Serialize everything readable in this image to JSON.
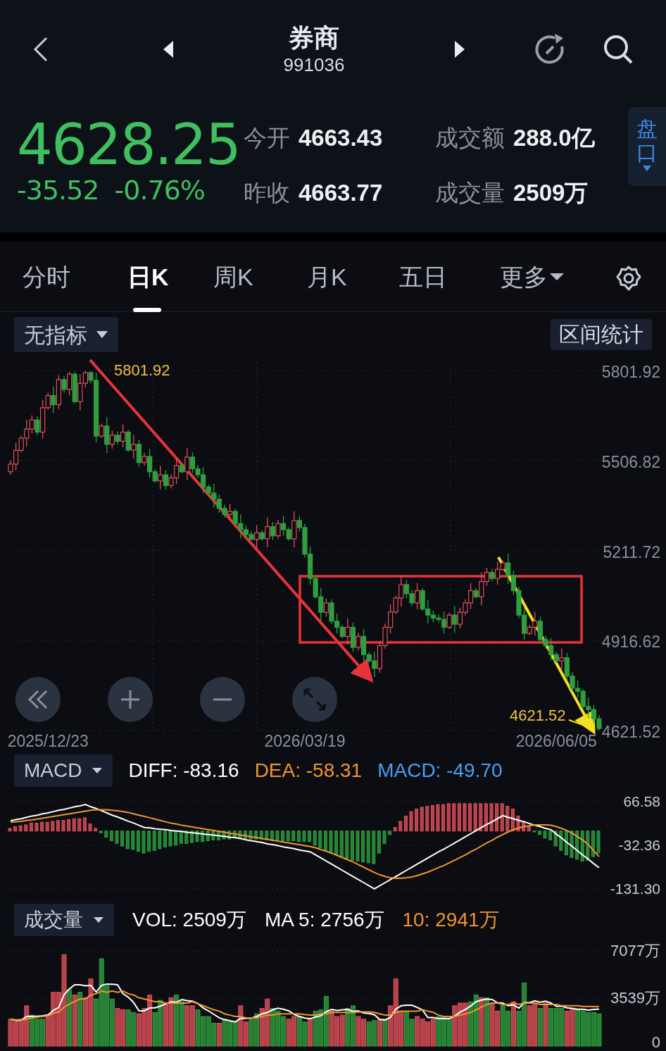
{
  "header": {
    "title": "券商",
    "code": "991036"
  },
  "quote": {
    "price": "4628.25",
    "change": "-35.52",
    "change_pct": "-0.76%",
    "stats": [
      {
        "label": "今开",
        "value": "4663.43"
      },
      {
        "label": "昨收",
        "value": "4663.77"
      },
      {
        "label": "成交额",
        "value": "288.0亿"
      },
      {
        "label": "成交量",
        "value": "2509万"
      }
    ],
    "side_tab": "盘口"
  },
  "tabs": [
    {
      "label": "分时",
      "selected": false
    },
    {
      "label": "日K",
      "selected": true
    },
    {
      "label": "周K",
      "selected": false
    },
    {
      "label": "月K",
      "selected": false
    },
    {
      "label": "五日",
      "selected": false
    },
    {
      "label": "更多",
      "selected": false
    }
  ],
  "kline": {
    "indicator": "无指标",
    "range_stats": "区间统计",
    "high_label": "5801.92",
    "low_label": "4621.52",
    "chart_data": {
      "type": "candlestick",
      "ylim": [
        4621.52,
        5801.92
      ],
      "grid": true,
      "yticks": [
        {
          "value": 5801.92,
          "label": "5801.92"
        },
        {
          "value": 5506.82,
          "label": "5506.82"
        },
        {
          "value": 5211.72,
          "label": "5211.72"
        },
        {
          "value": 4916.62,
          "label": "4916.62"
        },
        {
          "value": 4621.52,
          "label": "4621.52"
        }
      ],
      "categories": [
        null,
        null,
        null,
        null,
        null,
        null,
        null,
        "2025/12/23",
        null,
        null,
        null,
        null,
        null,
        null,
        null,
        null,
        null,
        null,
        null,
        null,
        null,
        null,
        null,
        null,
        null,
        null,
        null,
        null,
        null,
        null,
        null,
        null,
        null,
        null,
        null,
        null,
        null,
        null,
        null,
        null,
        null,
        null,
        null,
        null,
        null,
        null,
        null,
        null,
        null,
        null,
        null,
        null,
        null,
        null,
        null,
        "2026/03/19",
        null,
        null,
        null,
        null,
        null,
        null,
        null,
        null,
        null,
        null,
        null,
        null,
        null,
        null,
        null,
        null,
        null,
        null,
        null,
        null,
        null,
        null,
        null,
        null,
        null,
        null,
        null,
        null,
        null,
        null,
        null,
        null,
        null,
        null,
        null,
        null,
        null,
        null,
        null,
        null,
        null,
        null,
        null,
        null,
        null,
        null,
        "2026/06/05",
        null,
        null,
        null,
        null,
        null,
        null,
        null,
        null
      ],
      "ohlc": [
        [
          5470,
          5507,
          5460,
          5495
        ],
        [
          5495,
          5565,
          5475,
          5540
        ],
        [
          5540,
          5588,
          5534,
          5580
        ],
        [
          5580,
          5640,
          5552,
          5610
        ],
        [
          5610,
          5655,
          5596,
          5640
        ],
        [
          5640,
          5652,
          5590,
          5600
        ],
        [
          5600,
          5705,
          5580,
          5680
        ],
        [
          5680,
          5728,
          5674,
          5720
        ],
        [
          5720,
          5750,
          5662,
          5690
        ],
        [
          5690,
          5787,
          5676,
          5772
        ],
        [
          5772,
          5784,
          5730,
          5740
        ],
        [
          5740,
          5798,
          5720,
          5790
        ],
        [
          5790,
          5798,
          5694,
          5700
        ],
        [
          5700,
          5790,
          5672,
          5760
        ],
        [
          5760,
          5801.92,
          5746,
          5795
        ],
        [
          5795,
          5800,
          5760,
          5770
        ],
        [
          5770,
          5795,
          5567,
          5587
        ],
        [
          5587,
          5628,
          5581,
          5620
        ],
        [
          5620,
          5650,
          5532,
          5560
        ],
        [
          5560,
          5605,
          5546,
          5590
        ],
        [
          5590,
          5602,
          5560,
          5570
        ],
        [
          5570,
          5625,
          5550,
          5600
        ],
        [
          5600,
          5608,
          5535,
          5541
        ],
        [
          5541,
          5590,
          5513,
          5560
        ],
        [
          5560,
          5575,
          5486,
          5500
        ],
        [
          5500,
          5532,
          5490,
          5520
        ],
        [
          5520,
          5545,
          5450,
          5470
        ],
        [
          5470,
          5478,
          5434,
          5440
        ],
        [
          5440,
          5490,
          5412,
          5460
        ],
        [
          5460,
          5475,
          5411,
          5425
        ],
        [
          5425,
          5462,
          5415,
          5450
        ],
        [
          5450,
          5515,
          5430,
          5490
        ],
        [
          5490,
          5498,
          5464,
          5470
        ],
        [
          5470,
          5548,
          5442,
          5518
        ],
        [
          5518,
          5533,
          5466,
          5480
        ],
        [
          5480,
          5492,
          5450,
          5460
        ],
        [
          5460,
          5485,
          5400,
          5420
        ],
        [
          5420,
          5428,
          5394,
          5400
        ],
        [
          5400,
          5430,
          5352,
          5380
        ],
        [
          5380,
          5395,
          5336,
          5350
        ],
        [
          5350,
          5362,
          5320,
          5330
        ],
        [
          5330,
          5365,
          5310,
          5340
        ],
        [
          5340,
          5348,
          5294,
          5300
        ],
        [
          5300,
          5330,
          5252,
          5280
        ],
        [
          5280,
          5295,
          5250,
          5264
        ],
        [
          5264,
          5276,
          5246,
          5248
        ],
        [
          5248,
          5295,
          5220,
          5270
        ],
        [
          5270,
          5278,
          5244,
          5250
        ],
        [
          5250,
          5320,
          5222,
          5290
        ],
        [
          5290,
          5305,
          5246,
          5260
        ],
        [
          5260,
          5312,
          5250,
          5300
        ],
        [
          5300,
          5325,
          5260,
          5280
        ],
        [
          5280,
          5288,
          5244,
          5250
        ],
        [
          5250,
          5340,
          5222,
          5310
        ],
        [
          5310,
          5325,
          5273,
          5287
        ],
        [
          5287,
          5299,
          5190,
          5200
        ],
        [
          5200,
          5225,
          5100,
          5120
        ],
        [
          5120,
          5128,
          5054,
          5060
        ],
        [
          5060,
          5090,
          4981,
          5009
        ],
        [
          5009,
          5055,
          4995,
          5040
        ],
        [
          5040,
          5052,
          4970,
          4980
        ],
        [
          4980,
          5005,
          4940,
          4960
        ],
        [
          4960,
          4968,
          4924,
          4930
        ],
        [
          4930,
          4990,
          4902,
          4960
        ],
        [
          4960,
          4975,
          4880,
          4894
        ],
        [
          4894,
          4942,
          4884,
          4930
        ],
        [
          4930,
          4955,
          4850,
          4870
        ],
        [
          4870,
          4878,
          4844,
          4850
        ],
        [
          4850,
          4880,
          4797,
          4825
        ],
        [
          4825,
          4915,
          4811,
          4900
        ],
        [
          4900,
          4972,
          4890,
          4960
        ],
        [
          4960,
          5035,
          4940,
          5010
        ],
        [
          5010,
          5064,
          5004,
          5056
        ],
        [
          5056,
          5130,
          5028,
          5100
        ],
        [
          5100,
          5115,
          5056,
          5070
        ],
        [
          5070,
          5082,
          5030,
          5040
        ],
        [
          5040,
          5105,
          5020,
          5080
        ],
        [
          5080,
          5088,
          5014,
          5020
        ],
        [
          5020,
          5050,
          4972,
          5000
        ],
        [
          5000,
          5015,
          4976,
          4990
        ],
        [
          4990,
          5002,
          4976,
          4986
        ],
        [
          4986,
          5011,
          4940,
          4960
        ],
        [
          4960,
          5008,
          4954,
          5000
        ],
        [
          5000,
          5030,
          4942,
          4970
        ],
        [
          4970,
          5024,
          4956,
          5009
        ],
        [
          5009,
          5052,
          4999,
          5040
        ],
        [
          5040,
          5105,
          5020,
          5080
        ],
        [
          5080,
          5088,
          5054,
          5060
        ],
        [
          5060,
          5140,
          5032,
          5110
        ],
        [
          5110,
          5155,
          5096,
          5140
        ],
        [
          5140,
          5152,
          5110,
          5120
        ],
        [
          5120,
          5175,
          5100,
          5150
        ],
        [
          5150,
          5179,
          5144,
          5171
        ],
        [
          5171,
          5201,
          5102,
          5130
        ],
        [
          5130,
          5145,
          5066,
          5080
        ],
        [
          5080,
          5092,
          4990,
          5000
        ],
        [
          5000,
          5025,
          4920,
          4940
        ],
        [
          4940,
          4968,
          4934,
          4960
        ],
        [
          4960,
          5010,
          4932,
          4980
        ],
        [
          4980,
          4995,
          4906,
          4920
        ],
        [
          4920,
          4932,
          4890,
          4900
        ],
        [
          4900,
          4925,
          4851,
          4871
        ],
        [
          4871,
          4879,
          4844,
          4850
        ],
        [
          4850,
          4890,
          4822,
          4860
        ],
        [
          4860,
          4875,
          4786,
          4800
        ],
        [
          4800,
          4812,
          4750,
          4760
        ],
        [
          4760,
          4785,
          4730,
          4750
        ],
        [
          4750,
          4758,
          4694,
          4700
        ],
        [
          4700,
          4730,
          4662,
          4690
        ],
        [
          4690,
          4705,
          4646,
          4660
        ],
        [
          4660,
          4672,
          4621.52,
          4628
        ]
      ]
    }
  },
  "macd": {
    "selector": "MACD",
    "readouts": [
      {
        "text": "DIFF: -83.16",
        "color": "#ffffff"
      },
      {
        "text": "DEA: -58.31",
        "color": "#f0952e"
      },
      {
        "text": "MACD: -49.70",
        "color": "#4a9ef0"
      }
    ],
    "chart_data": {
      "type": "bar",
      "ylim": [
        -131.3,
        66.58
      ],
      "yticks": [
        {
          "value": 66.58,
          "label": "66.58"
        },
        {
          "value": -32.36,
          "label": "-32.36"
        },
        {
          "value": -131.3,
          "label": "-131.30"
        }
      ],
      "series": [
        {
          "type": "line",
          "color": "#ffffff",
          "values": [
            23,
            26,
            28,
            31,
            34,
            36,
            39,
            41,
            44,
            47,
            49,
            52,
            55,
            57,
            60,
            55,
            51,
            46,
            41,
            36,
            32,
            27,
            22,
            18,
            13,
            8,
            7,
            5,
            4,
            3,
            1,
            0,
            -1,
            -3,
            -4,
            -5,
            -7,
            -8,
            -9,
            -11,
            -12,
            -14,
            -15,
            -17,
            -20,
            -22,
            -24,
            -26,
            -29,
            -31,
            -33,
            -36,
            -38,
            -40,
            -43,
            -45,
            -47,
            -54,
            -61,
            -68,
            -75,
            -82,
            -89,
            -96,
            -103,
            -110,
            -117,
            -124,
            -131,
            -124,
            -117,
            -110,
            -103,
            -96,
            -89,
            -82,
            -75,
            -68,
            -61,
            -54,
            -47,
            -41,
            -34,
            -27,
            -20,
            -13,
            -6,
            1,
            8,
            15,
            21,
            28,
            35,
            31,
            28,
            24,
            21,
            17,
            13,
            10,
            6,
            3,
            -7,
            -16,
            -26,
            -35,
            -45,
            -55,
            -64,
            -74,
            -83
          ]
        },
        {
          "type": "line",
          "color": "#f0952e",
          "values": [
            20,
            21,
            22,
            24,
            25,
            27,
            29,
            31,
            33,
            35,
            37,
            39,
            41,
            43,
            45,
            47,
            48,
            48,
            48,
            47,
            46,
            44,
            42,
            39,
            36,
            33,
            30,
            27,
            24,
            21,
            18,
            16,
            13,
            11,
            9,
            7,
            5,
            3,
            1,
            -1,
            -3,
            -5,
            -7,
            -9,
            -11,
            -13,
            -15,
            -17,
            -19,
            -21,
            -23,
            -25,
            -27,
            -29,
            -31,
            -33,
            -35,
            -38,
            -42,
            -46,
            -50,
            -55,
            -60,
            -65,
            -70,
            -76,
            -82,
            -88,
            -94,
            -99,
            -103,
            -106,
            -107,
            -107,
            -106,
            -104,
            -101,
            -97,
            -93,
            -88,
            -83,
            -78,
            -72,
            -66,
            -60,
            -54,
            -47,
            -41,
            -34,
            -27,
            -21,
            -14,
            -8,
            -2,
            3,
            7,
            10,
            12,
            14,
            14,
            14,
            13,
            10,
            6,
            1,
            -5,
            -13,
            -21,
            -31,
            -45,
            -58
          ]
        },
        {
          "color": "#e0505a",
          "values": [
            6,
            10,
            12,
            14,
            18,
            18,
            20,
            20,
            22,
            24,
            24,
            26,
            28,
            28,
            30,
            16,
            6,
            null,
            null,
            null,
            null,
            null,
            null,
            null,
            null,
            null,
            null,
            null,
            null,
            null,
            null,
            null,
            null,
            null,
            null,
            null,
            null,
            null,
            null,
            null,
            null,
            null,
            null,
            null,
            null,
            null,
            null,
            null,
            null,
            null,
            null,
            null,
            null,
            null,
            null,
            null,
            null,
            null,
            null,
            null,
            null,
            null,
            null,
            null,
            null,
            null,
            null,
            null,
            null,
            null,
            null,
            null,
            8,
            22,
            34,
            44,
            50,
            54,
            56,
            58,
            60,
            60,
            62,
            62,
            62,
            62,
            62,
            62,
            62,
            62,
            62,
            62,
            62,
            56,
            50,
            34,
            22,
            10,
            null,
            null,
            null,
            null,
            null,
            null,
            null,
            null,
            null,
            null,
            null,
            null,
            null
          ]
        },
        {
          "color": "#2f9e3f",
          "values": [
            null,
            null,
            null,
            null,
            null,
            null,
            null,
            null,
            null,
            null,
            null,
            null,
            null,
            null,
            null,
            null,
            null,
            -4,
            -14,
            -22,
            -28,
            -34,
            -40,
            -42,
            -46,
            -50,
            -46,
            -44,
            -40,
            -36,
            -34,
            -32,
            -28,
            -28,
            -26,
            -24,
            -24,
            -22,
            -20,
            -20,
            -18,
            -18,
            -16,
            -16,
            -18,
            -18,
            -18,
            -18,
            -20,
            -20,
            -20,
            -22,
            -22,
            -22,
            -24,
            -24,
            -24,
            -32,
            -38,
            -44,
            -50,
            -54,
            -58,
            -62,
            -66,
            -68,
            -70,
            -72,
            -74,
            -50,
            -28,
            -8,
            null,
            null,
            null,
            null,
            null,
            null,
            null,
            null,
            null,
            null,
            null,
            null,
            null,
            null,
            null,
            null,
            null,
            null,
            null,
            null,
            null,
            null,
            null,
            null,
            null,
            null,
            -2,
            -8,
            -16,
            -20,
            -34,
            -44,
            -54,
            -60,
            -64,
            -68,
            -66,
            -58,
            -50
          ]
        }
      ]
    }
  },
  "volume": {
    "selector": "成交量",
    "readouts": [
      {
        "text": "VOL: 2509万",
        "color": "#ffffff"
      },
      {
        "text": "MA 5: 2756万",
        "color": "#ffffff"
      },
      {
        "text": "10: 2941万",
        "color": "#f0952e"
      }
    ],
    "chart_data": {
      "type": "bar",
      "ylim": [
        0,
        7077
      ],
      "yticks": [
        {
          "value": 0,
          "label": "0"
        },
        {
          "value": 3539,
          "label": "3539万"
        },
        {
          "value": 7077,
          "label": "7077万"
        }
      ],
      "series": [
        {
          "color": "#e0505a",
          "values": [
            2000,
            1800,
            2000,
            3000,
            null,
            null,
            null,
            2300,
            4000,
            4000,
            6800,
            null,
            3800,
            null,
            3600,
            5000,
            null,
            null,
            null,
            null,
            2800,
            2700,
            null,
            null,
            2400,
            2800,
            3800,
            null,
            null,
            3200,
            3600,
            null,
            null,
            3000,
            3000,
            null,
            null,
            null,
            null,
            1700,
            null,
            null,
            null,
            3000,
            1800,
            null,
            null,
            2800,
            3500,
            null,
            null,
            null,
            2000,
            2200,
            null,
            null,
            2000,
            null,
            null,
            null,
            2600,
            2200,
            2300,
            null,
            null,
            2200,
            2000,
            null,
            null,
            2000,
            null,
            3000,
            5000,
            2600,
            null,
            null,
            2200,
            2000,
            1800,
            2000,
            null,
            null,
            null,
            3000,
            3200,
            3200,
            null,
            null,
            3600,
            null,
            3200,
            2600,
            null,
            null,
            3300,
            null,
            null,
            3000,
            3200,
            null,
            3200,
            null,
            null,
            null,
            2600,
            2800,
            null,
            null,
            null,
            null,
            null
          ]
        },
        {
          "color": "#2f9e3f",
          "values": [
            null,
            null,
            null,
            null,
            2300,
            2000,
            2000,
            null,
            null,
            null,
            null,
            4200,
            null,
            4000,
            null,
            null,
            3500,
            6500,
            4500,
            3500,
            null,
            null,
            2700,
            2500,
            null,
            null,
            null,
            2500,
            3400,
            null,
            null,
            3800,
            3300,
            null,
            null,
            2700,
            2200,
            2200,
            1700,
            null,
            2000,
            1800,
            1800,
            null,
            null,
            2000,
            2400,
            null,
            null,
            2800,
            2600,
            2200,
            null,
            null,
            2200,
            1800,
            null,
            2600,
            2700,
            3700,
            null,
            null,
            null,
            2800,
            3000,
            null,
            null,
            1800,
            1900,
            null,
            2000,
            null,
            null,
            null,
            2600,
            2000,
            null,
            null,
            null,
            null,
            2200,
            2200,
            2000,
            null,
            null,
            null,
            3300,
            3800,
            null,
            3600,
            null,
            null,
            3000,
            2600,
            null,
            2600,
            4700,
            null,
            null,
            2800,
            null,
            2800,
            2800,
            2800,
            null,
            null,
            2700,
            2600,
            2500,
            2500,
            2400
          ]
        },
        {
          "type": "line",
          "color": "#ffffff",
          "values": [
            2000,
            1900,
            1930,
            2200,
            2220,
            2220,
            2260,
            2320,
            2660,
            2860,
            3820,
            4260,
            4560,
            4560,
            4480,
            4520,
            4020,
            4520,
            4620,
            4600,
            4560,
            3900,
            3640,
            3240,
            2620,
            2620,
            2840,
            2840,
            2980,
            3140,
            3300,
            3260,
            3460,
            3380,
            3340,
            3160,
            2840,
            2620,
            2360,
            2100,
            1960,
            1880,
            1800,
            2060,
            2060,
            2080,
            2200,
            2400,
            2500,
            2700,
            2820,
            2740,
            2620,
            2360,
            2200,
            2080,
            2040,
            2160,
            2260,
            2560,
            2720,
            2640,
            2700,
            2720,
            2580,
            2620,
            2460,
            2420,
            2340,
            1980,
            1940,
            2140,
            2760,
            3000,
            3040,
            3040,
            2880,
            2680,
            2120,
            2120,
            2040,
            2040,
            2040,
            2240,
            2520,
            2720,
            2980,
            3300,
            3420,
            3500,
            3460,
            3220,
            3200,
            3000,
            3060,
            2820,
            3240,
            3240,
            3360,
            3260,
            3340,
            3200,
            2960,
            2980,
            2840,
            2800,
            2740,
            2740,
            2680,
            2720,
            2760
          ]
        },
        {
          "type": "line",
          "color": "#f0952e",
          "values": [
            2000,
            1950,
            1950,
            2000,
            2100,
            2150,
            2200,
            2250,
            2450,
            2540,
            2900,
            3130,
            3320,
            3520,
            3520,
            3800,
            3900,
            4100,
            4000,
            4100,
            4000,
            4100,
            3900,
            3800,
            3600,
            3500,
            3400,
            3300,
            3300,
            3200,
            3200,
            3200,
            3200,
            3200,
            3300,
            3150,
            3000,
            2850,
            2700,
            2600,
            2400,
            2300,
            2200,
            2200,
            2100,
            2100,
            2100,
            2200,
            2300,
            2300,
            2400,
            2400,
            2400,
            2400,
            2400,
            2350,
            2300,
            2300,
            2400,
            2400,
            2500,
            2500,
            2500,
            2500,
            2500,
            2550,
            2550,
            2550,
            2500,
            2400,
            2300,
            2300,
            2500,
            2600,
            2600,
            2600,
            2600,
            2700,
            2600,
            2500,
            2300,
            2200,
            2200,
            2200,
            2300,
            2400,
            2500,
            2700,
            2900,
            3100,
            3200,
            3200,
            3100,
            3100,
            3200,
            3100,
            3200,
            3200,
            3200,
            3100,
            3100,
            3100,
            3100,
            3000,
            3000,
            3000,
            3000,
            2950,
            2950,
            2940,
            2940
          ]
        }
      ]
    }
  }
}
